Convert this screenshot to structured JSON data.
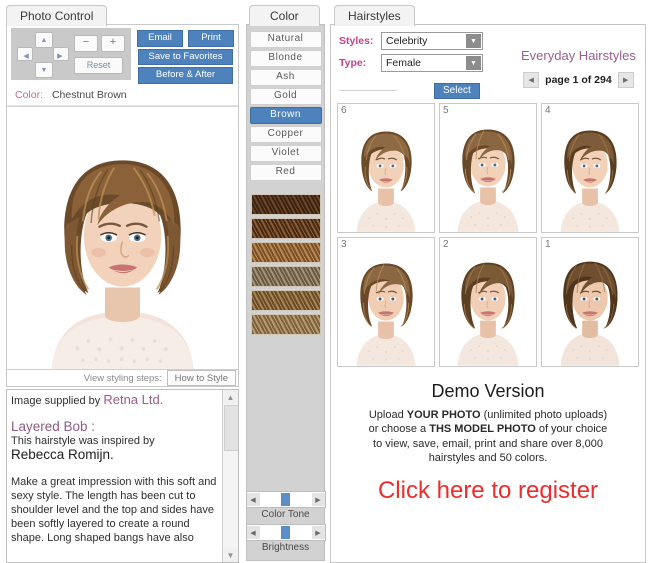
{
  "photo_control": {
    "tab_label": "Photo Control",
    "dpad": {
      "up": "up-arrow",
      "down": "down-arrow",
      "left": "left-arrow",
      "right": "right-arrow"
    },
    "zoom_out": "−",
    "zoom_in": "+",
    "reset": "Reset",
    "email": "Email",
    "print": "Print",
    "save_to_favorites": "Save to Favorites",
    "before_after": "Before & After",
    "color_label": "Color:",
    "color_value": "Chestnut Brown"
  },
  "styling_steps": {
    "label": "View styling steps:",
    "button": "How to Style"
  },
  "description": {
    "credit_prefix": "Image supplied by ",
    "credit_source": "Retna Ltd.",
    "style_name": "Layered Bob :",
    "inspired_prefix": "This hairstyle was inspired by",
    "celebrity": "Rebecca Romijn.",
    "body": "Make a great impression with this soft and sexy style. The length has been cut to shoulder level and the top and sides have been softly layered to create a round shape. Long shaped bangs have also"
  },
  "color_panel": {
    "tab_label": "Color",
    "families": [
      {
        "label": "Natural",
        "selected": false
      },
      {
        "label": "Blonde",
        "selected": false
      },
      {
        "label": "Ash",
        "selected": false
      },
      {
        "label": "Gold",
        "selected": false
      },
      {
        "label": "Brown",
        "selected": true
      },
      {
        "label": "Copper",
        "selected": false
      },
      {
        "label": "Violet",
        "selected": false
      },
      {
        "label": "Red",
        "selected": false
      }
    ],
    "swatches": [
      {
        "name": "dark-chocolate-brown",
        "base": "#3a2213",
        "stripe": "#6d4524"
      },
      {
        "name": "deep-espresso-brown",
        "base": "#472a16",
        "stripe": "#8a5c31"
      },
      {
        "name": "chestnut-brown",
        "base": "#7b5028",
        "stripe": "#b68a50"
      },
      {
        "name": "ash-brown",
        "base": "#6b5a42",
        "stripe": "#a3937a"
      },
      {
        "name": "medium-golden-brown",
        "base": "#6a4b2c",
        "stripe": "#a9854f"
      },
      {
        "name": "light-chestnut-brown",
        "base": "#7d6240",
        "stripe": "#b89c6f"
      }
    ],
    "color_tone_label": "Color Tone",
    "brightness_label": "Brightness",
    "slider_left_arrow": "◀",
    "slider_right_arrow": "▶"
  },
  "hairstyles": {
    "tab_label": "Hairstyles",
    "styles_label": "Styles:",
    "styles_value": "Celebrity",
    "type_label": "Type:",
    "type_value": "Female",
    "select_button": "Select",
    "category_title": "Everyday Hairstyles",
    "page_text": "page 1 of 294",
    "prev_arrow": "◀",
    "next_arrow": "▶",
    "thumbnails": [
      {
        "number": "6",
        "hair": "#8d6a44",
        "hair_dark": "#5e4427",
        "part": "center-layered"
      },
      {
        "number": "5",
        "hair": "#8a6742",
        "hair_dark": "#5b4125",
        "part": "side-wavy"
      },
      {
        "number": "4",
        "hair": "#7e5c3a",
        "hair_dark": "#53391f",
        "part": "center-bob"
      },
      {
        "number": "3",
        "hair": "#8b6843",
        "hair_dark": "#5c4226",
        "part": "side-bob"
      },
      {
        "number": "2",
        "hair": "#7b5a38",
        "hair_dark": "#50381e",
        "part": "tousled-bob"
      },
      {
        "number": "1",
        "hair": "#6f4f30",
        "hair_dark": "#47301a",
        "part": "textured-bob"
      }
    ]
  },
  "promo": {
    "headline": "Demo Version",
    "line1_a": "Upload ",
    "line1_b": "YOUR PHOTO",
    "line1_c": " (unlimited photo uploads)",
    "line2_a": "or choose a ",
    "line2_b": "THS MODEL PHOTO",
    "line2_c": " of your choice",
    "line3": "to view, save, email, print and share over 8,000",
    "line4": "hairstyles and 50 colors.",
    "register": "Click here to register"
  },
  "colors": {
    "accent_blue": "#4d82bd",
    "label_pink": "#c2418c",
    "promo_red": "#ef2c2c",
    "panel_gray": "#d2d2d2"
  }
}
